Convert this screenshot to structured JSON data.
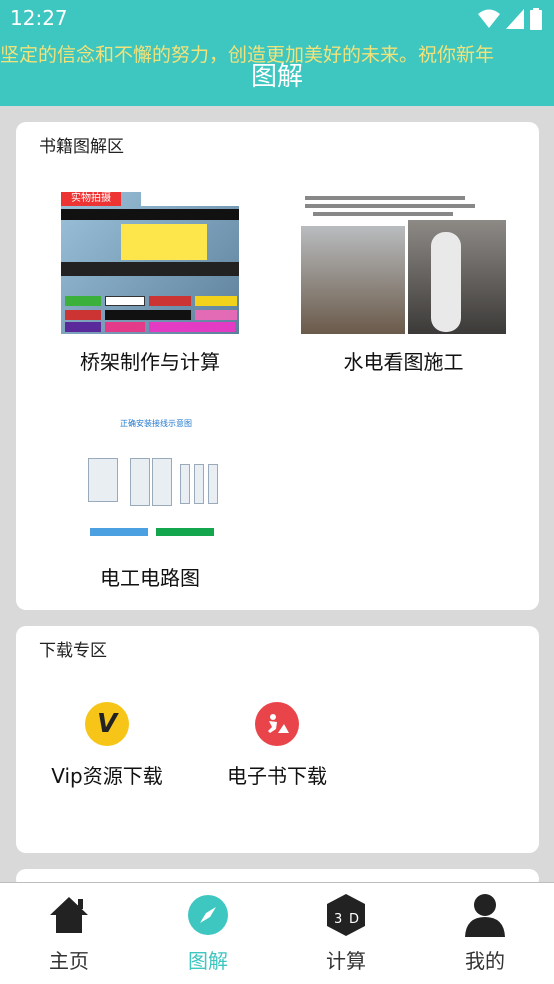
{
  "status_bar": {
    "time": "12:27"
  },
  "header": {
    "marquee": "坚定的信念和不懈的努力，创造更加美好的未来。祝你新年",
    "title": "图解"
  },
  "books_section": {
    "title": "书籍图解区",
    "items": [
      {
        "label": "桥架制作与计算",
        "thumb_text": "实物拍摄"
      },
      {
        "label": "水电看图施工"
      },
      {
        "label": "电工电路图",
        "thumb_text": "正确安装接线示意图"
      }
    ]
  },
  "download_section": {
    "title": "下载专区",
    "items": [
      {
        "label": "Vip资源下载",
        "icon_color": "#f6c518"
      },
      {
        "label": "电子书下载",
        "icon_color": "#e8444a"
      }
    ]
  },
  "bottom_nav": {
    "items": [
      {
        "label": "主页"
      },
      {
        "label": "图解",
        "active": true
      },
      {
        "label": "计算"
      },
      {
        "label": "我的"
      }
    ]
  },
  "colors": {
    "accent": "#3ec6c0",
    "marquee": "#f2e27a"
  }
}
